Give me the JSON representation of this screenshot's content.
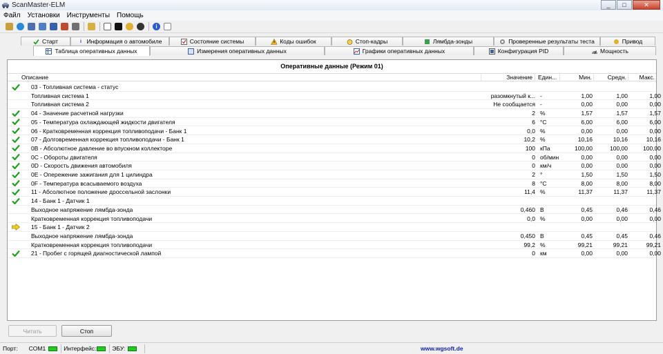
{
  "window": {
    "title": "ScanMaster-ELM",
    "minimize": "_",
    "maximize": "□",
    "close": "✕"
  },
  "menu": [
    "Файл",
    "Установки",
    "Инструменты",
    "Помощь"
  ],
  "tabs_row1": [
    "Старт",
    "Информация о автомобиле",
    "Состояние системы",
    "Коды ошибок",
    "Стоп-кадры",
    "Лямбда-зонды",
    "Проверенные результаты теста",
    "Привод"
  ],
  "tabs_row2": [
    "Таблица оперативных данных",
    "Измерения оперативных данных",
    "Графики оперативных данных",
    "Конфигурация PID",
    "Мощность"
  ],
  "grid": {
    "title": "Оперативные данные (Режим 01)",
    "headers": {
      "desc": "Описание",
      "value": "Значение",
      "unit": "Един...",
      "min": "Мин.",
      "avg": "Средн.",
      "max": "Макс."
    },
    "rows": [
      {
        "icon": "check",
        "desc": "03 - Топливная система - статус",
        "value": "",
        "unit": "",
        "min": "",
        "avg": "",
        "max": ""
      },
      {
        "icon": "",
        "desc": "Топливная система 1",
        "value": "разомкнутый к...",
        "unit": "-",
        "min": "1,00",
        "avg": "1,00",
        "max": "1,00"
      },
      {
        "icon": "",
        "desc": "Топливная система 2",
        "value": "Не сообщается",
        "unit": "-",
        "min": "0,00",
        "avg": "0,00",
        "max": "0,00"
      },
      {
        "icon": "check",
        "desc": "04 - Значение расчетной нагрузки",
        "value": "2",
        "unit": "%",
        "min": "1,57",
        "avg": "1,57",
        "max": "1,57"
      },
      {
        "icon": "check",
        "desc": "05 - Температура охлаждающей жидкости двигателя",
        "value": "6",
        "unit": "°C",
        "min": "6,00",
        "avg": "6,00",
        "max": "6,00"
      },
      {
        "icon": "check",
        "desc": "06 - Кратковременная коррекция топливоподачи - Банк 1",
        "value": "0,0",
        "unit": "%",
        "min": "0,00",
        "avg": "0,00",
        "max": "0,00"
      },
      {
        "icon": "check",
        "desc": "07 - Долговременная коррекция топливоподачи - Банк 1",
        "value": "10,2",
        "unit": "%",
        "min": "10,16",
        "avg": "10,16",
        "max": "10,16"
      },
      {
        "icon": "check",
        "desc": "0B - Абсолютное давление во впускном коллекторе",
        "value": "100",
        "unit": "кПа",
        "min": "100,00",
        "avg": "100,00",
        "max": "100,00"
      },
      {
        "icon": "check",
        "desc": "0C - Обороты двигателя",
        "value": "0",
        "unit": "об/мин",
        "min": "0,00",
        "avg": "0,00",
        "max": "0,00"
      },
      {
        "icon": "check",
        "desc": "0D - Скорость движения автомобиля",
        "value": "0",
        "unit": "км/ч",
        "min": "0,00",
        "avg": "0,00",
        "max": "0,00"
      },
      {
        "icon": "check",
        "desc": "0E - Опережение зажигания для 1 цилиндра",
        "value": "2",
        "unit": "°",
        "min": "1,50",
        "avg": "1,50",
        "max": "1,50"
      },
      {
        "icon": "check",
        "desc": "0F - Температура всасываемого воздуха",
        "value": "8",
        "unit": "°C",
        "min": "8,00",
        "avg": "8,00",
        "max": "8,00"
      },
      {
        "icon": "check",
        "desc": "11 - Абсолютное положение дроссельной заслонки",
        "value": "11,4",
        "unit": "%",
        "min": "11,37",
        "avg": "11,37",
        "max": "11,37"
      },
      {
        "icon": "check",
        "desc": "14 - Банк 1 - Датчик 1",
        "value": "",
        "unit": "",
        "min": "",
        "avg": "",
        "max": ""
      },
      {
        "icon": "",
        "desc": "Выходное напряжение лямбда-зонда",
        "value": "0,460",
        "unit": "В",
        "min": "0,45",
        "avg": "0,46",
        "max": "0,46"
      },
      {
        "icon": "",
        "desc": "Кратковременная коррекция топливоподачи",
        "value": "0,0",
        "unit": "%",
        "min": "0,00",
        "avg": "0,00",
        "max": "0,00"
      },
      {
        "icon": "arrow",
        "desc": "15 - Банк 1 - Датчик 2",
        "value": "",
        "unit": "",
        "min": "",
        "avg": "",
        "max": ""
      },
      {
        "icon": "",
        "desc": "Выходное напряжение лямбда-зонда",
        "value": "0,450",
        "unit": "В",
        "min": "0,45",
        "avg": "0,45",
        "max": "0,46"
      },
      {
        "icon": "",
        "desc": "Кратковременная коррекция топливоподачи",
        "value": "99,2",
        "unit": "%",
        "min": "99,21",
        "avg": "99,21",
        "max": "99,21"
      },
      {
        "icon": "check",
        "desc": "21 - Пробег с горящей диагностической лампой",
        "value": "0",
        "unit": "км",
        "min": "0,00",
        "avg": "0,00",
        "max": "0,00"
      }
    ]
  },
  "buttons": {
    "read": "Читать",
    "stop": "Стоп"
  },
  "status": {
    "port_label": "Порт:",
    "port_value": "COM1",
    "interface_label": "Интерфейс:",
    "ecu_label": "ЭБУ:",
    "website": "www.wgsoft.de",
    "led_color": "#22cc22"
  }
}
